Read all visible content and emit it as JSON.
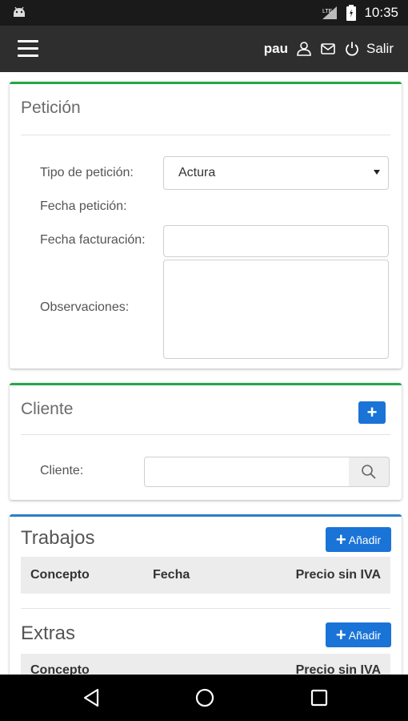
{
  "status_bar": {
    "time": "10:35",
    "icons": [
      "android-icon",
      "signal-icon",
      "battery-icon"
    ]
  },
  "app_bar": {
    "menu_icon": "hamburger-icon",
    "username": "pau",
    "logout_label": "Salir"
  },
  "peticion": {
    "title": "Petición",
    "tipo_label": "Tipo de petición:",
    "tipo_value": "Actura",
    "fecha_peticion_label": "Fecha petición:",
    "fecha_facturacion_label": "Fecha facturación:",
    "fecha_facturacion_value": "",
    "observaciones_label": "Observaciones:",
    "observaciones_value": ""
  },
  "cliente": {
    "title": "Cliente",
    "cliente_label": "Cliente:",
    "cliente_value": ""
  },
  "trabajos": {
    "title": "Trabajos",
    "add_label": "Añadir",
    "columns": [
      "Concepto",
      "Fecha",
      "Precio sin IVA"
    ]
  },
  "extras": {
    "title": "Extras",
    "add_label": "Añadir",
    "columns": [
      "Concepto",
      "Precio sin IVA"
    ]
  },
  "colors": {
    "accent_green": "#28a745",
    "accent_blue": "#2d7ec7",
    "button_blue": "#1a73d6"
  }
}
